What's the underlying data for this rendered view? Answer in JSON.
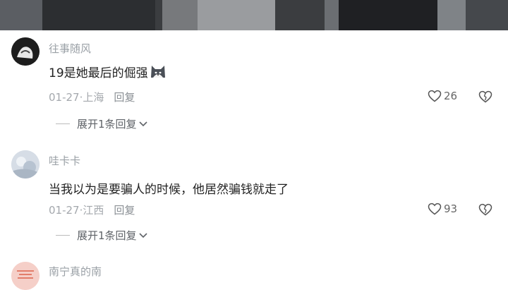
{
  "video": {
    "label": "video-preview"
  },
  "comments": [
    {
      "username": "往事随风",
      "text": "19是她最后的倔强",
      "emoji": "cat-face-emoji",
      "date": "01-27",
      "location": "上海",
      "reply_label": "回复",
      "likes": "26",
      "expand_label": "展开1条回复"
    },
    {
      "username": "哇卡卡",
      "text": "当我以为是要骗人的时候，他居然骗钱就走了",
      "date": "01-27",
      "location": "江西",
      "reply_label": "回复",
      "likes": "93",
      "expand_label": "展开1条回复"
    },
    {
      "username": "南宁真的南"
    }
  ],
  "colors": {
    "username": "#9aa0a6",
    "text": "#222222",
    "meta": "#a4a8ad"
  },
  "separator": "·"
}
